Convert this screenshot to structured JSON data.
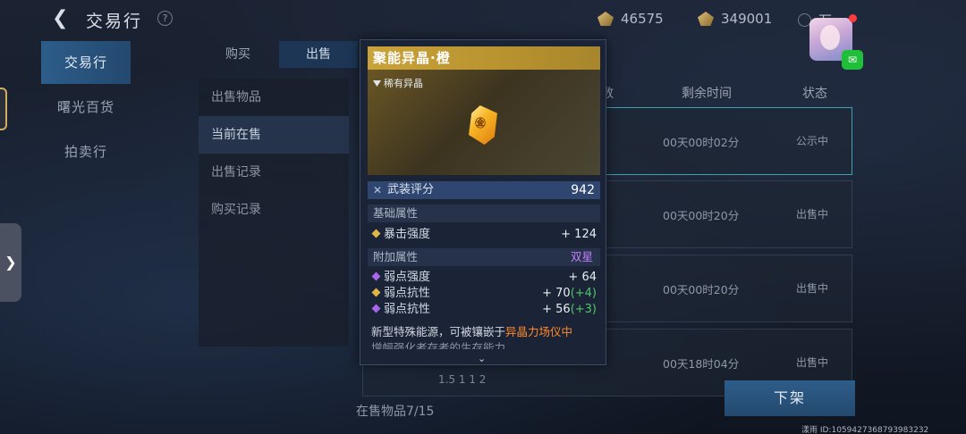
{
  "header": {
    "title": "交易行",
    "help": "?",
    "currency1": "46575",
    "currency2": "349001",
    "currency3": "万",
    "wechat": "✉"
  },
  "nav": {
    "items": [
      "交易行",
      "曙光百货",
      "拍卖行"
    ],
    "active_index": 0
  },
  "subtabs": [
    "购买",
    "出售"
  ],
  "sell_menu": [
    "出售物品",
    "当前在售",
    "出售记录",
    "购买记录"
  ],
  "table": {
    "headers": [
      "数",
      "剩余时间",
      "状态"
    ],
    "rows": [
      {
        "time": "00天00时02分",
        "status": "公示中"
      },
      {
        "time": "00天00时20分",
        "status": "出售中"
      },
      {
        "time": "00天00时20分",
        "status": "出售中"
      },
      {
        "time": "00天18时04分",
        "status": "出售中"
      }
    ],
    "row_bottom_partial": "1.5 1 1 2"
  },
  "footer": {
    "withdraw_label": "下架",
    "onsale_count": "在售物品7/15",
    "user_id": "漾雨  ID:105942736879398​3232"
  },
  "tooltip": {
    "name": "聚能异晶·橙",
    "rarity": "稀有异晶",
    "crystal_mark": "㊎",
    "score_icon": "✕",
    "score_label": "武装评分",
    "score_value": "942",
    "basic_title": "基础属性",
    "basic_attrs": [
      {
        "name": "暴击强度",
        "value": "+ 124",
        "bonus": ""
      }
    ],
    "extra_title": "附加属性",
    "extra_tag": "双星",
    "extra_attrs": [
      {
        "name": "弱点强度",
        "value": "+ 64",
        "bonus": ""
      },
      {
        "name": "弱点抗性",
        "value": "+ 70",
        "bonus": "(+4)"
      },
      {
        "name": "弱点抗性",
        "value": "+ 56",
        "bonus": "(+3)"
      }
    ],
    "desc_prefix": "新型特殊能源，可被镶嵌于",
    "desc_highlight": "异晶力场仪中",
    "desc_cut": "增幅强化者存者的生存能力",
    "scroll_icon": "⌄"
  },
  "colors": {
    "accent": "#2d5d8a",
    "gold_title": "#c9a23a",
    "purple_tag": "#c77dff",
    "bonus_green": "#4fc46b",
    "highlight_orange": "#ff8a2a"
  }
}
